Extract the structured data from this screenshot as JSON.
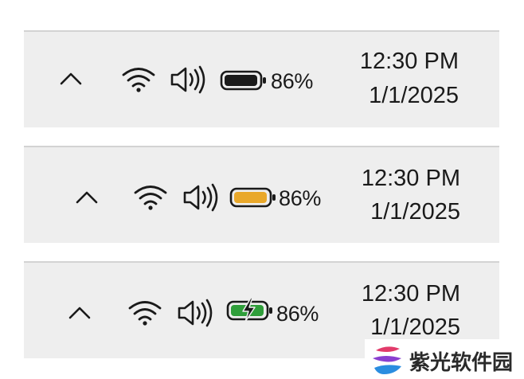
{
  "taskbars": [
    {
      "variant": "normal",
      "battery_percent_label": "86%",
      "battery_level": 0.86,
      "battery_fill_color": "#1a1a1a",
      "battery_icon": "battery-icon",
      "time": "12:30 PM",
      "date": "1/1/2025"
    },
    {
      "variant": "low-power",
      "battery_percent_label": "86%",
      "battery_level": 0.86,
      "battery_fill_color": "#e9a82a",
      "battery_icon": "battery-saver-icon",
      "time": "12:30 PM",
      "date": "1/1/2025"
    },
    {
      "variant": "charging",
      "battery_percent_label": "86%",
      "battery_level": 0.86,
      "battery_fill_color": "#2f9e3a",
      "battery_icon": "battery-charging-icon",
      "time": "12:30 PM",
      "date": "1/1/2025"
    }
  ],
  "icons": {
    "chevron": "chevron-up-icon",
    "network": "wifi-icon",
    "sound": "speaker-icon"
  },
  "watermark": {
    "text": "紫光软件园"
  }
}
